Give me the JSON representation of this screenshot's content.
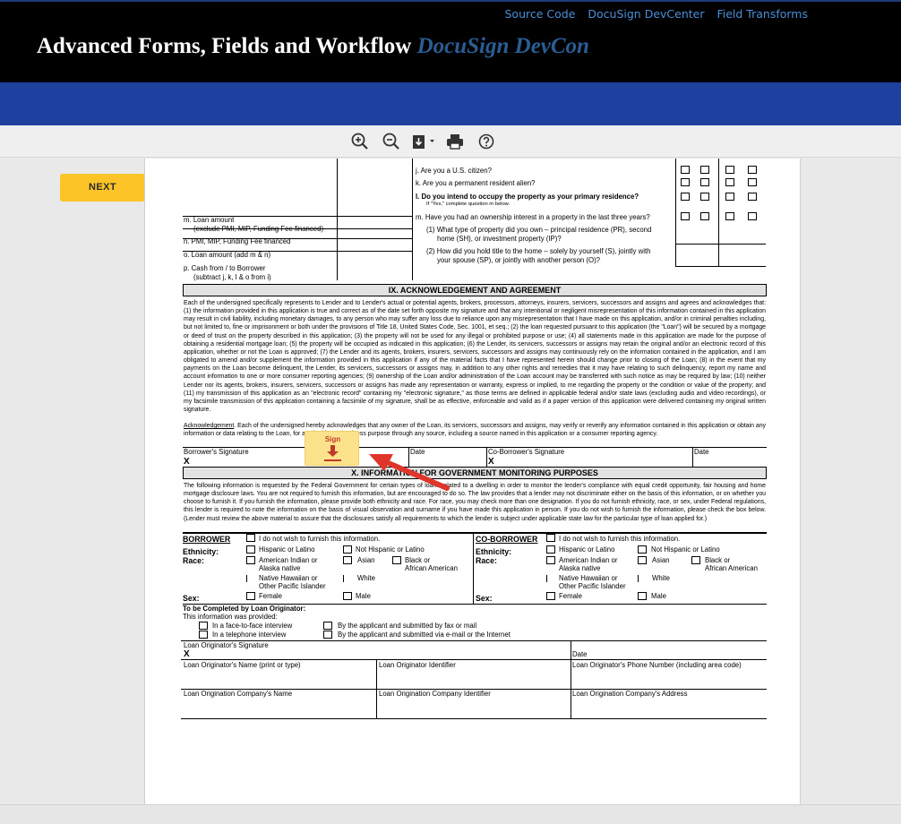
{
  "header": {
    "links": [
      "Source Code",
      "DocuSign DevCenter",
      "Field Transforms"
    ],
    "title": "Advanced Forms, Fields and Workflow",
    "title_accent": "DocuSign DevCon"
  },
  "toolbar": {
    "icons": [
      "zoom-in-icon",
      "zoom-out-icon",
      "download-icon",
      "print-icon",
      "help-icon"
    ]
  },
  "next_button": "NEXT",
  "sign_tag": "Sign",
  "colors": {
    "brand_band": "#1e41a0",
    "next": "#fdc427",
    "link": "#4a8fd8",
    "accent": "#2a5d93"
  },
  "form": {
    "questions": {
      "j": "j.  Are you a U.S. citizen?",
      "k": "k.  Are you a permanent resident alien?",
      "l": "l.   Do you intend to occupy the property as your primary residence?",
      "l_note": "If \"Yes,\" complete question m below.",
      "m": "m.  Have you had an ownership interest in a property in the last three years?",
      "m1_1": "(1)  What type of property did you own – principal residence (PR), second",
      "m1_2": "home (SH), or investment property (IP)?",
      "m2_1": "(2)  How did you hold title to the home – solely by yourself (S), jointly with",
      "m2_2": "your spouse (SP), or jointly with another person (O)?"
    },
    "left_items": {
      "m1": "m. Loan amount",
      "m2": "(exclude PMI, MIP, Funding Fee financed)",
      "n": "n.  PMI, MIP, Funding Fee financed",
      "o": "o.  Loan amount (add m & n)",
      "p1": "p.  Cash from / to Borrower",
      "p2": "(subtract j, k, l & o from i)"
    },
    "section9": {
      "title": "IX. ACKNOWLEDGEMENT AND AGREEMENT",
      "paragraph": "Each of the undersigned specifically represents to Lender and to Lender's actual or potential agents, brokers, processors, attorneys, insurers, servicers, successors and assigns and agrees and acknowledges that: (1) the information provided in this application is true and correct as of the date set forth opposite my signature and that any intentional or negligent misrepresentation of this information contained in this application may result in civil liability, including monetary damages, to any person who may suffer any loss due to reliance upon any misrepresentation that I have made on this application, and/or in criminal penalties including, but not limited to, fine or imprisonment or both under the provisions of Title 18, United States Code, Sec. 1001, et seq.; (2) the loan requested pursuant to this application (the \"Loan\") will be secured by a mortgage or deed of trust on the property described in this application; (3) the property will not be used for any illegal or prohibited purpose or use; (4) all statements made in this application are made for the purpose of obtaining a residential mortgage loan; (5) the property will be occupied as indicated in this application; (6) the Lender, its servicers, successors or assigns may retain the original and/or an electronic record of this application, whether or not the Loan is approved; (7) the Lender and its agents, brokers, insurers, servicers, successors and assigns may continuously rely on the information contained in the application, and I am obligated to amend and/or supplement the information provided in this application if any of the material facts that I have represented herein should change prior to closing of the Loan; (8) in the event that my payments on the Loan become delinquent, the Lender, its servicers, successors or assigns may, in addition to any other rights and remedies that it may have relating to such delinquency, report my name and account information to one or more consumer reporting agencies; (9) ownership of the Loan and/or administration of the Loan account may be transferred with such notice as may be required by law; (10) neither Lender nor its agents, brokers, insurers, servicers, successors or assigns has made any representation or warranty, express or implied, to me regarding the property or the condition or value of the property; and (11) my transmission of this application as an \"electronic record\" containing my \"electronic signature,\" as those terms are defined in applicable federal and/or state laws (excluding audio and video recordings), or my facsimile transmission of this application containing a facsimile of my signature, shall be as effective, enforceable and valid as if a paper version of this application were delivered containing my original written signature.",
      "ack_label": "Acknowledgement",
      "ack_text": ". Each of the undersigned hereby acknowledges that any owner of the Loan, its servicers, successors and assigns, may verify or reverify any information contained in this application or obtain any information or data relating to the Loan, for any legitimate business purpose through any source, including a source named in this application or a consumer reporting agency.",
      "borrower_sig": "Borrower's Signature",
      "date": "Date",
      "coborrower_sig": "Co-Borrower's Signature",
      "x": "X"
    },
    "section10": {
      "title": "X. INFORMATION FOR GOVERNMENT MONITORING PURPOSES",
      "paragraph": "The following information is requested by the Federal Government for certain types of loans related to a dwelling in order to monitor the lender's compliance with equal credit opportunity, fair housing and home mortgage disclosure laws. You are not required to furnish this information, but are encouraged to do so. The law provides that a lender may not discriminate either on the basis of this information, or on whether you choose to furnish it. If you furnish the information, please provide both ethnicity and race. For race, you may check more than one designation. If you do not furnish ethnicity, race, or sex, under Federal regulations, this lender is required to note the information on the basis of visual observation and surname if you have made this application in person. If you do not wish to furnish the information, please check the box below. (Lender must review the above material to assure that the disclosures satisfy all requirements to which the lender is subject under applicable state law for the particular type of loan applied for.)",
      "borrower": "BORROWER",
      "coborrower": "CO-BORROWER",
      "no_furnish": "I do not wish to furnish this information.",
      "ethnicity": "Ethnicity:",
      "race": "Race:",
      "sex": "Sex:",
      "hispanic": "Hispanic or Latino",
      "not_hispanic": "Not Hispanic or Latino",
      "amer_ind_1": "American Indian or",
      "amer_ind_2": "Alaska native",
      "asian": "Asian",
      "black_1": "Black or",
      "black_2": "African American",
      "nhpi_1": "Native Hawaiian or",
      "nhpi_2": "Other Pacific Islander",
      "white": "White",
      "female": "Female",
      "male": "Male"
    },
    "originator": {
      "heading": "To be Completed by Loan Originator:",
      "provided": "This information was provided:",
      "face": "In a face-to-face interview",
      "phone": "In a telephone interview",
      "fax": "By the applicant and submitted by fax or mail",
      "email": "By the applicant and submitted via e-mail or the Internet",
      "sig": "Loan Originator's Signature",
      "x": "X",
      "date": "Date",
      "name": "Loan Originator's Name (print or type)",
      "identifier": "Loan Originator Identifier",
      "phone_num": "Loan Originator's Phone Number (including area code)",
      "company": "Loan Origination Company's Name",
      "company_id": "Loan Origination Company Identifier",
      "company_addr": "Loan Origination Company's Address"
    }
  }
}
